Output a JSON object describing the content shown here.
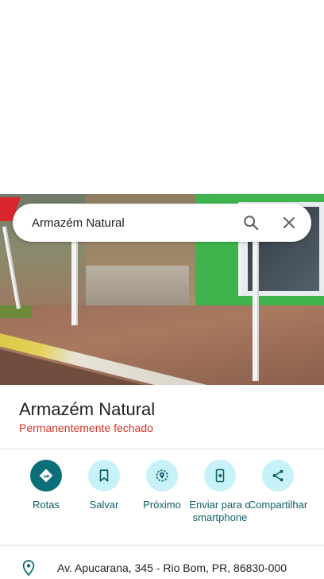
{
  "search": {
    "query": "Armazém Natural"
  },
  "place": {
    "name": "Armazém Natural",
    "status": "Permanentemente fechado",
    "status_color": "#d93025"
  },
  "actions": [
    {
      "label": "Rotas",
      "icon": "directions-icon",
      "primary": true
    },
    {
      "label": "Salvar",
      "icon": "bookmark-icon"
    },
    {
      "label": "Próximo",
      "icon": "nearby-icon"
    },
    {
      "label": "Enviar para o smartphone",
      "icon": "send-to-phone-icon"
    },
    {
      "label": "Compartilhar",
      "icon": "share-icon"
    }
  ],
  "address": {
    "text": "Av. Apucarana, 345 - Rio Bom, PR, 86830-000",
    "icon": "location-pin-icon"
  },
  "colors": {
    "accent": "#0b6f7a",
    "accent_light": "#c7f2f7",
    "action_text": "#0e5e67"
  }
}
